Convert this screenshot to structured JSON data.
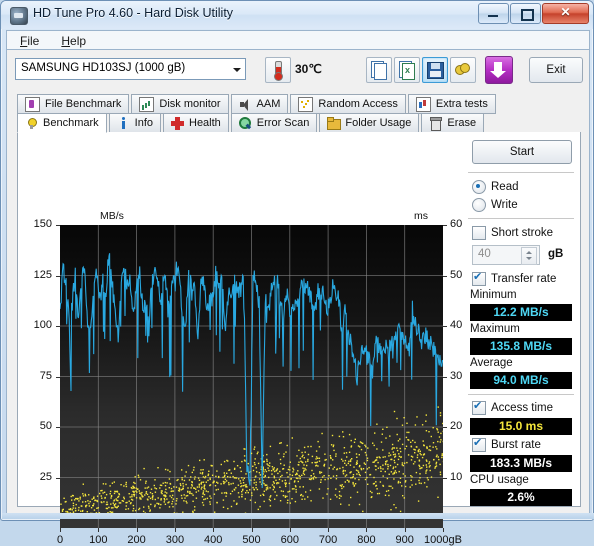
{
  "window": {
    "title": "HD Tune Pro 4.60 - Hard Disk Utility",
    "icon": "hdd-icon",
    "minimize": "",
    "maximize": "",
    "close": "✕"
  },
  "menu": {
    "items": [
      "File",
      "Help"
    ]
  },
  "toolbar": {
    "drive": "SAMSUNG HD103SJ (1000 gB)",
    "temperature": "30℃",
    "buttons": [
      {
        "name": "copy-to-clipboard-button",
        "icon": "copy-icon"
      },
      {
        "name": "export-excel-button",
        "icon": "excel-export-icon"
      },
      {
        "name": "save-button",
        "icon": "floppy-save-icon"
      },
      {
        "name": "options-button",
        "icon": "gears-icon"
      },
      {
        "name": "download-button",
        "icon": "down-arrow-icon"
      }
    ],
    "exit_label": "Exit"
  },
  "tabs_top": [
    {
      "label": "File Benchmark",
      "icon": "flask-icon"
    },
    {
      "label": "Disk monitor",
      "icon": "bar-chart-icon"
    },
    {
      "label": "AAM",
      "icon": "speaker-icon"
    },
    {
      "label": "Random Access",
      "icon": "scatter-icon"
    },
    {
      "label": "Extra tests",
      "icon": "extra-tests-icon"
    }
  ],
  "tabs_main": [
    {
      "label": "Benchmark",
      "icon": "lightbulb-icon",
      "active": true
    },
    {
      "label": "Info",
      "icon": "info-icon",
      "active": false
    },
    {
      "label": "Health",
      "icon": "red-cross-icon",
      "active": false
    },
    {
      "label": "Error Scan",
      "icon": "magnifier-icon",
      "active": false
    },
    {
      "label": "Folder Usage",
      "icon": "folder-icon",
      "active": false
    },
    {
      "label": "Erase",
      "icon": "trash-icon",
      "active": false
    }
  ],
  "sidebar": {
    "start_label": "Start",
    "mode": {
      "read_label": "Read",
      "write_label": "Write",
      "selected": "Read"
    },
    "short_stroke": {
      "label": "Short stroke",
      "checked": false,
      "value": "40",
      "unit": "gB"
    },
    "transfer_rate": {
      "label": "Transfer rate",
      "checked": true
    },
    "minimum": {
      "label": "Minimum",
      "value": "12.2 MB/s",
      "color": "#4fd8f5"
    },
    "maximum": {
      "label": "Maximum",
      "value": "135.8 MB/s",
      "color": "#4fd8f5"
    },
    "average": {
      "label": "Average",
      "value": "94.0 MB/s",
      "color": "#4fd8f5"
    },
    "access_time": {
      "label": "Access time",
      "checked": true,
      "value": "15.0 ms",
      "color": "#f5e73c"
    },
    "burst_rate": {
      "label": "Burst rate",
      "checked": true,
      "value": "183.3 MB/s",
      "color": "#ffffff"
    },
    "cpu_usage": {
      "label": "CPU usage",
      "value": "2.6%",
      "color": "#ffffff"
    }
  },
  "chart_data": {
    "type": "line",
    "title": "",
    "xlabel": "gB",
    "ylabel": "MB/s",
    "y2label": "ms",
    "xlim": [
      0,
      1000
    ],
    "ylim": [
      0,
      150
    ],
    "y2lim": [
      0,
      60
    ],
    "xticks": [
      0,
      100,
      200,
      300,
      400,
      500,
      600,
      700,
      800,
      900,
      1000
    ],
    "yticks": [
      25,
      50,
      75,
      100,
      125,
      150
    ],
    "y2ticks": [
      10,
      20,
      30,
      40,
      50,
      60
    ],
    "grid": true,
    "background": "#0d0d0d",
    "legend": "none",
    "series": [
      {
        "name": "Transfer rate",
        "type": "line",
        "color": "#29a8e0",
        "axis": "left",
        "unit": "MB/s",
        "x": [
          0,
          8,
          16,
          24,
          32,
          40,
          48,
          56,
          64,
          72,
          80,
          88,
          96,
          104,
          112,
          120,
          128,
          136,
          144,
          152,
          160,
          168,
          176,
          184,
          192,
          200,
          208,
          216,
          224,
          232,
          240,
          248,
          256,
          264,
          272,
          280,
          288,
          296,
          304,
          312,
          320,
          328,
          336,
          344,
          352,
          360,
          368,
          376,
          384,
          392,
          400,
          408,
          416,
          424,
          432,
          440,
          448,
          456,
          464,
          472,
          480,
          488,
          496,
          504,
          512,
          520,
          528,
          536,
          544,
          552,
          560,
          568,
          576,
          584,
          592,
          600,
          608,
          616,
          624,
          632,
          640,
          648,
          656,
          664,
          672,
          680,
          688,
          696,
          704,
          712,
          720,
          728,
          736,
          744,
          752,
          760,
          768,
          776,
          784,
          792,
          800,
          808,
          816,
          824,
          832,
          840,
          848,
          856,
          864,
          872,
          880,
          888,
          896,
          904,
          912,
          920,
          928,
          936,
          944,
          952,
          960,
          968,
          976,
          984,
          992,
          1000
        ],
        "values": [
          104,
          128,
          122,
          100,
          112,
          126,
          103,
          126,
          127,
          104,
          99,
          119,
          126,
          113,
          122,
          116,
          137,
          120,
          108,
          93,
          124,
          129,
          121,
          121,
          105,
          122,
          126,
          109,
          114,
          99,
          123,
          126,
          121,
          112,
          127,
          118,
          111,
          123,
          128,
          124,
          106,
          100,
          128,
          116,
          118,
          93,
          124,
          122,
          110,
          112,
          114,
          129,
          120,
          122,
          99,
          118,
          114,
          123,
          119,
          116,
          125,
          30,
          24,
          126,
          120,
          111,
          19,
          115,
          108,
          118,
          122,
          122,
          111,
          105,
          117,
          103,
          111,
          113,
          114,
          120,
          119,
          118,
          113,
          104,
          118,
          116,
          118,
          107,
          113,
          119,
          117,
          114,
          96,
          107,
          96,
          92,
          82,
          75,
          85,
          88,
          86,
          82,
          77,
          93,
          90,
          88,
          91,
          86,
          92,
          95,
          99,
          96,
          94,
          92,
          88,
          112,
          101,
          98,
          91,
          96,
          93,
          92,
          88,
          84,
          85,
          82
        ]
      },
      {
        "name": "Access time",
        "type": "scatter",
        "color": "#f5e73c",
        "axis": "right",
        "unit": "ms",
        "mean": 15.0,
        "range": [
          3,
          25
        ],
        "description": "Yellow scattered access time samples rising from ~5 ms near 0 gB to ~20 ms near 1000 gB"
      }
    ]
  }
}
